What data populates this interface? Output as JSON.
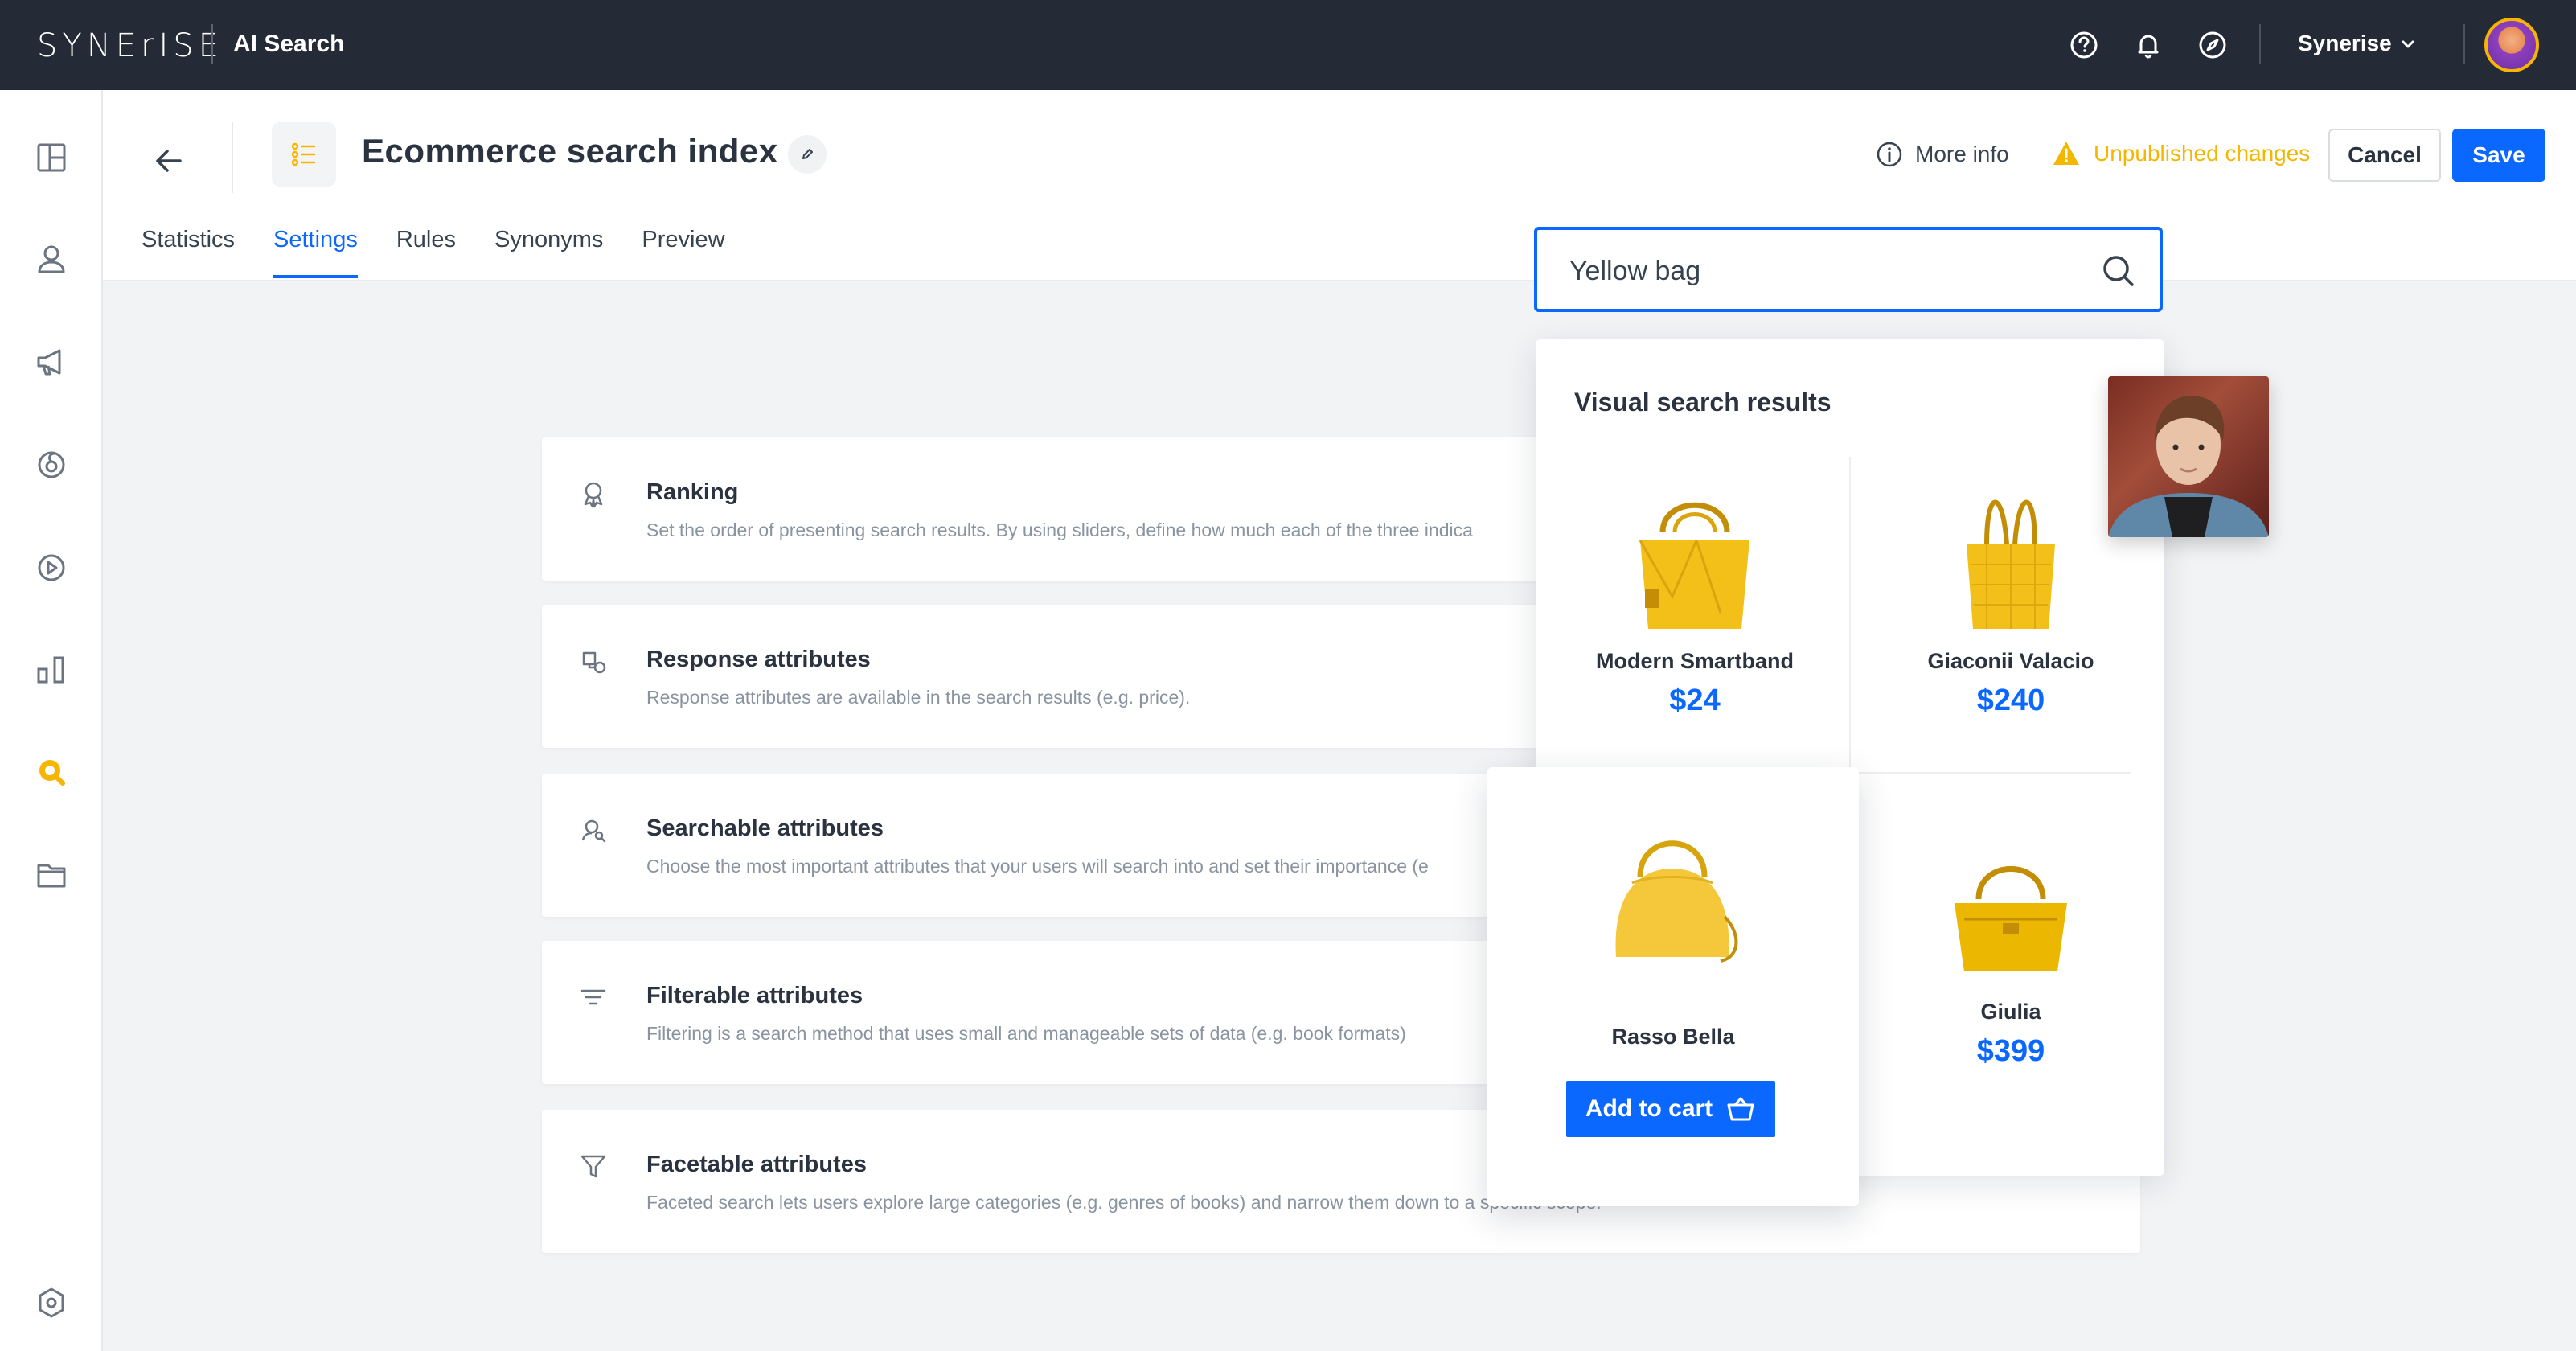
{
  "topbar": {
    "logo": "SYNErISE",
    "app_name": "AI Search",
    "org_name": "Synerise",
    "icons": [
      "help-icon",
      "bell-icon",
      "compass-icon",
      "chevron-down-icon",
      "avatar"
    ]
  },
  "sidebar": {
    "items": [
      "dashboard-icon",
      "profile-icon",
      "megaphone-icon",
      "automation-icon",
      "play-icon",
      "analytics-icon",
      "ai-search-icon",
      "folder-icon"
    ],
    "bottom_item": "settings-icon",
    "active_color": "#f7b500"
  },
  "header": {
    "title": "Ecommerce search index",
    "more_info": "More info",
    "unpublished": "Unpublished changes",
    "cancel_label": "Cancel",
    "save_label": "Save",
    "tabs": [
      {
        "label": "Statistics",
        "active": false
      },
      {
        "label": "Settings",
        "active": true
      },
      {
        "label": "Rules",
        "active": false
      },
      {
        "label": "Synonyms",
        "active": false
      },
      {
        "label": "Preview",
        "active": false
      }
    ]
  },
  "settings": [
    {
      "title": "Ranking",
      "desc": "Set the order of presenting search results. By using sliders, define how much each of the three indica",
      "icon": "award-icon"
    },
    {
      "title": "Response attributes",
      "desc": "Response attributes are available in the search results (e.g. price).",
      "icon": "response-icon"
    },
    {
      "title": "Searchable attributes",
      "desc": "Choose the most important attributes that your users will search into and set their importance (e",
      "icon": "user-search-icon"
    },
    {
      "title": "Filterable attributes",
      "desc": "Filtering is a search method that uses small and manageable sets of data (e.g. book formats)",
      "icon": "filter-lines-icon"
    },
    {
      "title": "Facetable attributes",
      "desc": "Faceted search lets users explore large categories (e.g. genres of books) and narrow them down to a specific scope.",
      "icon": "funnel-icon"
    }
  ],
  "search": {
    "value": "Yellow bag",
    "results_title": "Visual search results",
    "products": [
      {
        "name": "Modern Smartband",
        "price": "$24"
      },
      {
        "name": "Giaconii Valacio",
        "price": "$240"
      },
      {
        "name": "Rasso Bella",
        "cta": "Add to cart"
      },
      {
        "name": "Giulia",
        "price": "$399"
      }
    ]
  },
  "colors": {
    "primary": "#0b68ff",
    "warning": "#f3b700",
    "topbar": "#242a36",
    "bag_yellow": "#f2c019"
  }
}
